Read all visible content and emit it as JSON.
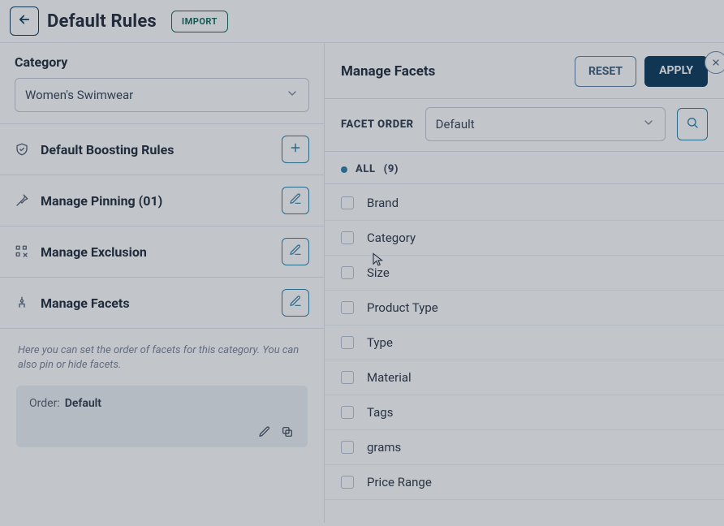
{
  "header": {
    "title": "Default Rules",
    "import_label": "IMPORT"
  },
  "category": {
    "heading": "Category",
    "selected": "Women's Swimwear"
  },
  "rows": {
    "boost": "Default Boosting Rules",
    "pinning": "Manage Pinning (01)",
    "exclusion": "Manage Exclusion",
    "facets": "Manage Facets"
  },
  "facets_hint": "Here you can set the order of facets for this category. You can also pin or hide facets.",
  "order_card": {
    "label": "Order:",
    "value": "Default"
  },
  "panel": {
    "title": "Manage Facets",
    "reset": "RESET",
    "apply": "APPLY",
    "facet_order_label": "FACET ORDER",
    "facet_order_value": "Default",
    "all_label": "ALL",
    "all_count": "(9)",
    "items": [
      "Brand",
      "Category",
      "Size",
      "Product Type",
      "Type",
      "Material",
      "Tags",
      "grams",
      "Price Range"
    ]
  }
}
